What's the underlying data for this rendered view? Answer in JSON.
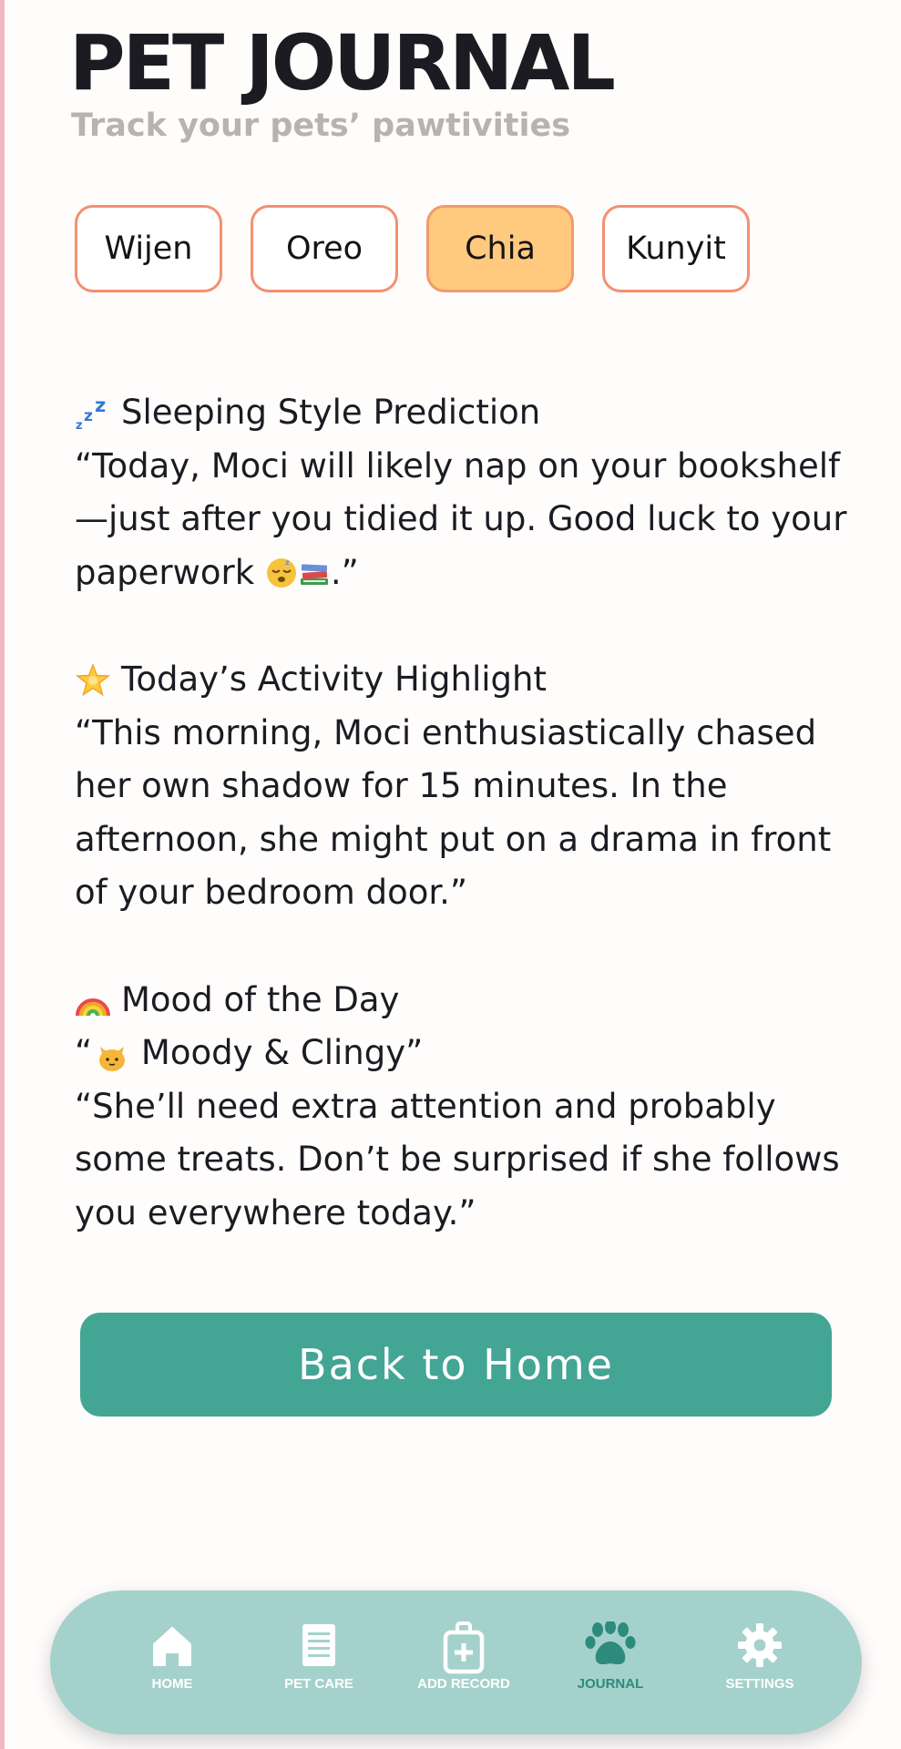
{
  "app": {
    "title": "PET JOURNAL",
    "subtitle": "Track your pets’ pawtivities"
  },
  "pets": [
    {
      "name": "Wijen",
      "active": false
    },
    {
      "name": "Oreo",
      "active": false
    },
    {
      "name": "Chia",
      "active": true
    },
    {
      "name": "Kunyit",
      "active": false
    }
  ],
  "journal": {
    "sleep": {
      "icon": "zzz-icon",
      "title": "Sleeping Style Prediction",
      "text_before": "“Today, Moci will likely nap on your bookshelf—just after you tidied it up. Good luck to your paperwork ",
      "text_icons": [
        "sleeping-face-icon",
        "books-icon"
      ],
      "text_after": ".”"
    },
    "activity": {
      "icon": "glowing-star-icon",
      "title": "Today’s Activity Highlight",
      "text": "“This morning, Moci enthusiastically chased her own shadow for 15 minutes. In the afternoon, she might put on a drama in front of your bedroom door.”"
    },
    "mood": {
      "icon": "rainbow-icon",
      "title": "Mood of the Day",
      "tag_open": "“",
      "tag_icon": "cat-face-icon",
      "tag_label": " Moody & Clingy”",
      "text": "“She’ll need extra attention and probably some treats. Don’t be surprised if she follows you everywhere today.”"
    }
  },
  "actions": {
    "back_label": "Back to Home"
  },
  "nav": {
    "home": "HOME",
    "pet_care": "PET CARE",
    "add_record": "ADD RECORD",
    "journal": "JOURNAL",
    "settings": "SETTINGS",
    "active": "journal"
  },
  "colors": {
    "accent_teal": "#43A594",
    "nav_bg": "#A5D1CC",
    "nav_active": "#2D8B7D",
    "tab_border": "#F39072",
    "tab_active_bg": "#FFC97E",
    "subtitle": "#B6B3B1",
    "left_strip": "#F1B9C3"
  }
}
